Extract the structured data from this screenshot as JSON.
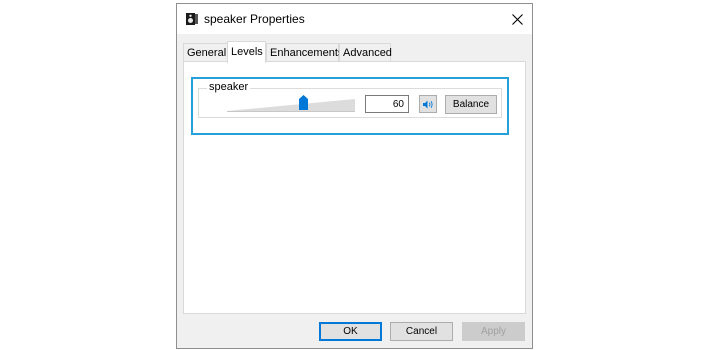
{
  "window": {
    "title": "speaker Properties",
    "icon": "speaker-icon"
  },
  "tabs": [
    {
      "label": "General",
      "active": false
    },
    {
      "label": "Levels",
      "active": true
    },
    {
      "label": "Enhancements",
      "active": false
    },
    {
      "label": "Advanced",
      "active": false
    }
  ],
  "levels": {
    "device_label": "speaker",
    "volume": 60,
    "volume_max": 100,
    "volume_text": "60",
    "mute_icon": "speaker-unmuted-icon",
    "balance_label": "Balance"
  },
  "footer": {
    "ok_label": "OK",
    "cancel_label": "Cancel",
    "apply_label": "Apply",
    "apply_enabled": false
  },
  "colors": {
    "accent": "#0078d7",
    "focus_border": "#26a0da"
  }
}
